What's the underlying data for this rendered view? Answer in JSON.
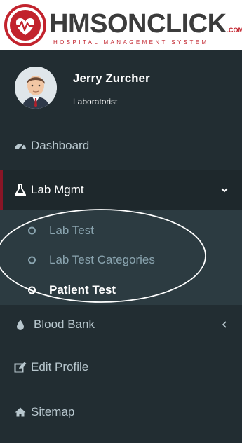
{
  "brand": {
    "name": "HMSONCLICK",
    "suffix": ".COM",
    "tagline": "HOSPITAL MANAGEMENT SYSTEM",
    "accent_color": "#c2232d"
  },
  "user": {
    "name": "Jerry Zurcher",
    "role": "Laboratorist"
  },
  "sidebar": {
    "background": "#222d32",
    "items": [
      {
        "label": "Dashboard",
        "icon": "tachometer-icon"
      },
      {
        "label": "Lab Mgmt",
        "icon": "flask-icon",
        "expanded": true,
        "chevron": "chevron-down-icon",
        "children": [
          {
            "label": "Lab Test"
          },
          {
            "label": "Lab Test Categories"
          },
          {
            "label": "Patient Test",
            "current": true
          }
        ]
      },
      {
        "label": "Blood Bank",
        "icon": "droplet-icon",
        "chevron": "chevron-left-icon"
      },
      {
        "label": "Edit Profile",
        "icon": "edit-icon"
      },
      {
        "label": "Sitemap",
        "icon": "home-icon"
      }
    ]
  }
}
